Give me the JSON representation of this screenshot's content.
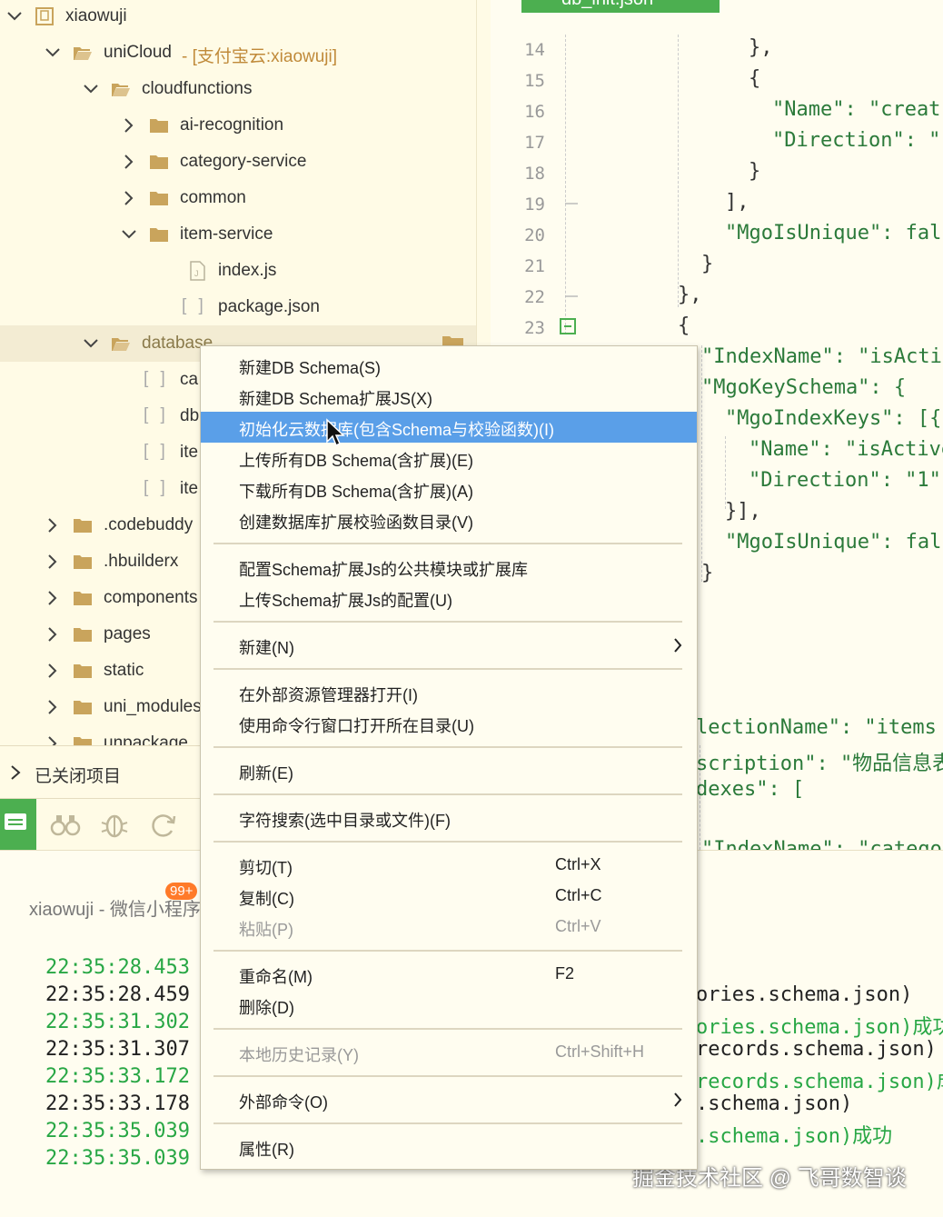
{
  "explorer": {
    "items": [
      {
        "label": "xiaowuji",
        "type": "project",
        "expanded": true
      },
      {
        "label": "uniCloud",
        "suffix": " - [支付宝云:xiaowuji]",
        "type": "cloud-folder",
        "expanded": true
      },
      {
        "label": "cloudfunctions",
        "type": "open-folder",
        "expanded": true
      },
      {
        "label": "ai-recognition",
        "type": "folder",
        "expanded": false
      },
      {
        "label": "category-service",
        "type": "folder",
        "expanded": false
      },
      {
        "label": "common",
        "type": "folder",
        "expanded": false
      },
      {
        "label": "item-service",
        "type": "folder",
        "expanded": true
      },
      {
        "label": "index.js",
        "type": "js-file"
      },
      {
        "label": "package.json",
        "type": "json-file"
      },
      {
        "label": "database",
        "type": "open-folder",
        "expanded": true,
        "selected": true
      },
      {
        "label": "ca",
        "type": "json-file"
      },
      {
        "label": "db",
        "type": "json-file"
      },
      {
        "label": "ite",
        "type": "json-file"
      },
      {
        "label": "ite",
        "type": "json-file"
      },
      {
        "label": ".codebuddy",
        "type": "folder",
        "expanded": false
      },
      {
        "label": ".hbuilderx",
        "type": "folder",
        "expanded": false
      },
      {
        "label": "components",
        "type": "folder",
        "expanded": false
      },
      {
        "label": "pages",
        "type": "folder",
        "expanded": false
      },
      {
        "label": "static",
        "type": "folder",
        "expanded": false
      },
      {
        "label": "uni_modules",
        "type": "folder",
        "expanded": false
      },
      {
        "label": "unpackage",
        "type": "folder",
        "expanded": false
      }
    ],
    "closed_projects": "已关闭项目",
    "json_glyph": "[ ]"
  },
  "editor": {
    "tab": "db_init.json",
    "line_numbers": [
      "14",
      "15",
      "16",
      "17",
      "18",
      "19",
      "20",
      "21",
      "22",
      "23"
    ],
    "code": {
      "l14": "},",
      "l15": "{",
      "l16": "\"Name\": \"creat",
      "l17": "\"Direction\": \"",
      "l18": "}",
      "l19": "],",
      "l20": "\"MgoIsUnique\": fal",
      "l21": "}",
      "l22": "},",
      "l23": "{",
      "l24": "\"IndexName\": \"isActi",
      "l25": "\"MgoKeySchema\": {",
      "l26": "\"MgoIndexKeys\": [{",
      "l27": "\"Name\": \"isActive",
      "l28": "\"Direction\": \"1\"",
      "l29": "}],",
      "l30": "\"MgoIsUnique\": fal",
      "l31": "}",
      "l35": "lectionName\": \"items",
      "l36": "scription\": \"物品信息表",
      "l37": "dexes\": [",
      "l39": "\"IndexName\": \"catego"
    }
  },
  "context_menu": {
    "items": [
      {
        "label": "新建DB Schema(S)",
        "shortcut": ""
      },
      {
        "label": "新建DB Schema扩展JS(X)",
        "shortcut": ""
      },
      {
        "label": "初始化云数据库(包含Schema与校验函数)(I)",
        "shortcut": "",
        "highlighted": true
      },
      {
        "label": "上传所有DB Schema(含扩展)(E)",
        "shortcut": ""
      },
      {
        "label": "下载所有DB Schema(含扩展)(A)",
        "shortcut": ""
      },
      {
        "label": "创建数据库扩展校验函数目录(V)",
        "shortcut": ""
      },
      {
        "label": "配置Schema扩展Js的公共模块或扩展库",
        "shortcut": ""
      },
      {
        "label": "上传Schema扩展Js的配置(U)",
        "shortcut": ""
      },
      {
        "label": "新建(N)",
        "shortcut": "",
        "submenu": true
      },
      {
        "label": "在外部资源管理器打开(I)",
        "shortcut": ""
      },
      {
        "label": "使用命令行窗口打开所在目录(U)",
        "shortcut": ""
      },
      {
        "label": "刷新(E)",
        "shortcut": ""
      },
      {
        "label": "字符搜索(选中目录或文件)(F)",
        "shortcut": ""
      },
      {
        "label": "剪切(T)",
        "shortcut": "Ctrl+X"
      },
      {
        "label": "复制(C)",
        "shortcut": "Ctrl+C"
      },
      {
        "label": "粘贴(P)",
        "shortcut": "Ctrl+V",
        "disabled": true
      },
      {
        "label": "重命名(M)",
        "shortcut": "F2"
      },
      {
        "label": "删除(D)",
        "shortcut": ""
      },
      {
        "label": "本地历史记录(Y)",
        "shortcut": "Ctrl+Shift+H",
        "disabled": true
      },
      {
        "label": "外部命令(O)",
        "shortcut": "",
        "submenu": true
      },
      {
        "label": "属性(R)",
        "shortcut": ""
      }
    ]
  },
  "console": {
    "title": "xiaowuji - 微信小程序",
    "badge": "99+",
    "logs": [
      {
        "time": "22:35:28.453",
        "msg": "",
        "success": true
      },
      {
        "time": "22:35:28.459",
        "msg": "ories.schema.json)",
        "success": false
      },
      {
        "time": "22:35:31.302",
        "msg": "ories.schema.json)成功",
        "success": true
      },
      {
        "time": "22:35:31.307",
        "msg": "records.schema.json)",
        "success": false
      },
      {
        "time": "22:35:33.172",
        "msg": "records.schema.json)成",
        "success": true
      },
      {
        "time": "22:35:33.178",
        "msg": ".schema.json)",
        "success": false
      },
      {
        "time": "22:35:35.039",
        "msg": ".schema.json)成功",
        "success": true
      },
      {
        "time": "22:35:35.039",
        "msg": "",
        "success": true
      }
    ]
  },
  "watermark": "掘金技术社区 @ 飞哥数智谈",
  "colors": {
    "accent_green": "#4caf50",
    "highlight_blue": "#5a9fe8",
    "folder": "#c9a45c",
    "log_green": "#28a745"
  }
}
